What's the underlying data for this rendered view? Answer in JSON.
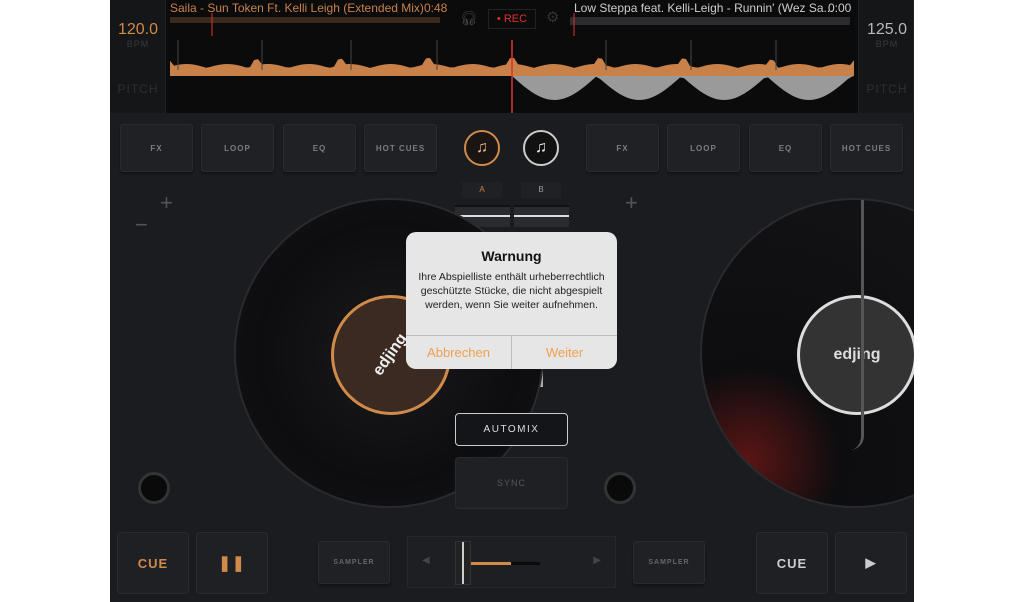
{
  "deck_a": {
    "title": "Saila - Sun Token Ft. Kelli Leigh (Extended Mix)",
    "time": "0:48",
    "bpm": "120.0",
    "bpm_label": "BPM",
    "pitch_label": "PITCH",
    "pads": [
      "FX",
      "LOOP",
      "EQ",
      "HOT CUES"
    ],
    "cue": "CUE",
    "play_state": "pause",
    "label_logo": "edjling",
    "channel": "A",
    "color": "#d08a4a"
  },
  "deck_b": {
    "title": "Low Steppa feat. Kelli-Leigh - Runnin' (Wez Sa...",
    "time": "0:00",
    "bpm": "125.0",
    "bpm_label": "BPM",
    "pitch_label": "PITCH",
    "pads": [
      "FX",
      "LOOP",
      "EQ",
      "HOT CUES"
    ],
    "cue": "CUE",
    "play_state": "play",
    "label_logo": "edjling",
    "channel": "B"
  },
  "rec_label": "• REC",
  "automix": "AUTOMIX",
  "sync": "SYNC",
  "sampler": "SAMPLER",
  "crossfader": {
    "position": 0.05
  },
  "dialog": {
    "title": "Warnung",
    "message": "Ihre Abspielliste enthält urheberrechtlich geschützte Stücke, die nicht abgespielt werden, wenn Sie weiter aufnehmen.",
    "cancel": "Abbrechen",
    "confirm": "Weiter"
  },
  "colors": {
    "accent": "#d08a4a",
    "rec": "#e03030",
    "dialog_button": "#f0a050"
  }
}
